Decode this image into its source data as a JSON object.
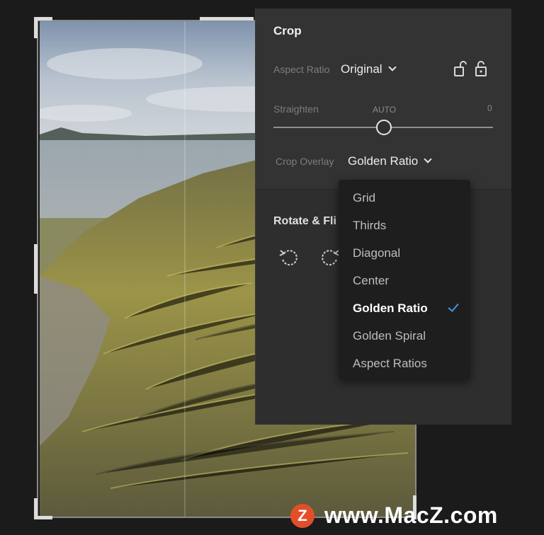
{
  "panel": {
    "title": "Crop",
    "aspect_ratio_label": "Aspect Ratio",
    "aspect_ratio_value": "Original",
    "straighten_label": "Straighten",
    "straighten_auto": "AUTO",
    "straighten_value": "0",
    "crop_overlay_label": "Crop Overlay",
    "crop_overlay_value": "Golden Ratio",
    "rotate_flip_label": "Rotate & Fli"
  },
  "menu": {
    "items": [
      "Grid",
      "Thirds",
      "Diagonal",
      "Center",
      "Golden Ratio",
      "Golden Spiral",
      "Aspect Ratios"
    ],
    "selected": "Golden Ratio"
  },
  "watermark": {
    "logo": "Z",
    "text": "www.MacZ.com"
  },
  "colors": {
    "accent": "#4a90e2",
    "panel": "#333333",
    "menu": "#1e1e1e",
    "watermark": "#e24e2a"
  },
  "icons": [
    "lock-open-icon",
    "lock-closed-icon",
    "chevron-down-icon",
    "rotate-left-icon",
    "rotate-right-icon",
    "checkmark-icon"
  ]
}
